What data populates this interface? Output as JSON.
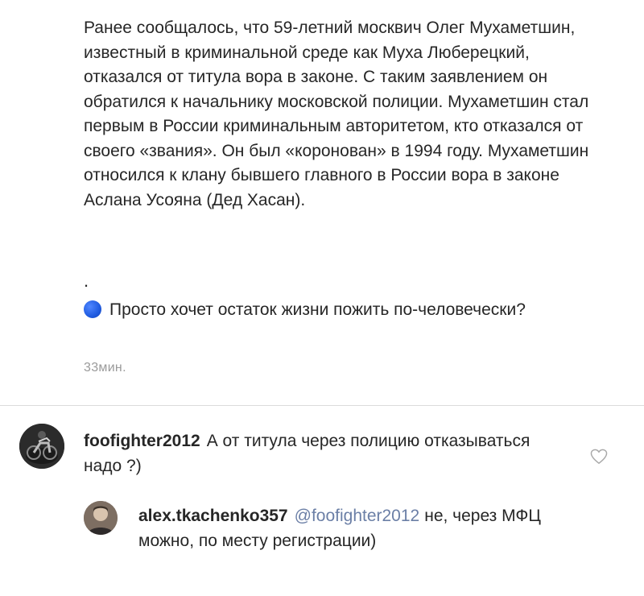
{
  "post": {
    "caption": "Ранее сообщалось, что 59-летний москвич Олег Мухаметшин, известный в криминальной среде как Муха Люберецкий, отказался от титула вора в законе. С таким заявлением он обратился к начальнику московской полиции. Мухаметшин стал первым в России криминальным авторитетом, кто отказался от своего «звания». Он был «коронован» в 1994 году. Мухаметшин относился к клану бывшего главного в России вора в законе Аслана Усояна (Дед Хасан).",
    "dot": ".",
    "question": "Просто хочет остаток жизни пожить по-человечески?",
    "question_icon": "blue-circle-emoji",
    "time": "33мин."
  },
  "comments": [
    {
      "username": "foofighter2012",
      "text": "А от титула через полицию отказываться надо ?)",
      "avatar_icon": "motorcycle-avatar",
      "like_icon": "heart-icon"
    }
  ],
  "replies": [
    {
      "username": "alex.tkachenko357",
      "mention": "@foofighter2012",
      "text": "не, через МФЦ можно, по месту регистрации)",
      "avatar_icon": "person-avatar"
    }
  ],
  "colors": {
    "text": "#262626",
    "muted": "#9a9a9a",
    "mention": "#6b7fa6",
    "divider": "#dbdbdb"
  }
}
